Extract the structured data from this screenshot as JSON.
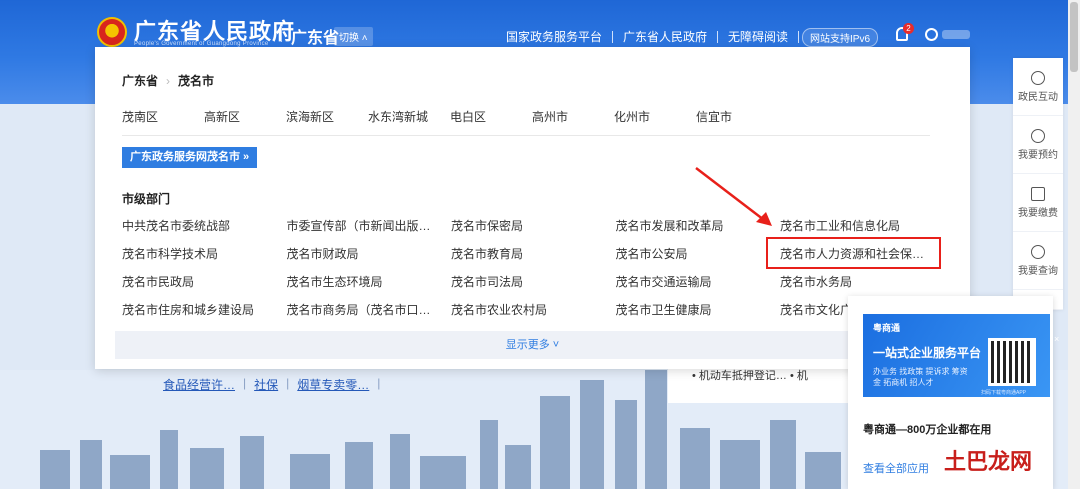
{
  "header": {
    "site_title": "广东省人民政府",
    "site_subtitle": "People's Government of Guangdong Province",
    "region": "广东省",
    "switch_label": "切换",
    "links": [
      "国家政务服务平台",
      "广东省人民政府",
      "无障碍阅读"
    ],
    "ipv6_label": "网站支持IPv6",
    "notification_count": "2"
  },
  "panel": {
    "breadcrumb": [
      "广东省",
      "茂名市"
    ],
    "districts": [
      "茂南区",
      "高新区",
      "滨海新区",
      "水东湾新城",
      "电白区",
      "高州市",
      "化州市",
      "信宜市"
    ],
    "portal_button": "广东政务服务网茂名市 »",
    "section_title": "市级部门",
    "departments": [
      "中共茂名市委统战部",
      "市委宣传部（市新闻出版…",
      "茂名市保密局",
      "茂名市发展和改革局",
      "茂名市工业和信息化局",
      "茂名市科学技术局",
      "茂名市财政局",
      "茂名市教育局",
      "茂名市公安局",
      "茂名市人力资源和社会保…",
      "茂名市民政局",
      "茂名市生态环境局",
      "茂名市司法局",
      "茂名市交通运输局",
      "茂名市水务局",
      "茂名市住房和城乡建设局",
      "茂名市商务局（茂名市口…",
      "茂名市农业农村局",
      "茂名市卫生健康局",
      "茂名市文化广"
    ],
    "show_more": "显示更多"
  },
  "under_links": [
    "食品经营许…",
    "社保",
    "烟草专卖零…"
  ],
  "under_list_item": "• 机动车抵押登记… •  机",
  "right_sidebar": [
    "政民互动",
    "我要预约",
    "我要缴费",
    "我要查询"
  ],
  "ad": {
    "logo": "粤商通",
    "headline": "一站式企业服务平台",
    "tags": "办业务  找政策  提诉求  筹资金  拓商机  招人才",
    "qr_caption": "扫码下载粤商通APP",
    "close": "×",
    "text": "粤商通—800万企业都在用",
    "link": "查看全部应用"
  },
  "watermark": "土巴龙网",
  "colors": {
    "header_blue": "#2f79e3",
    "accent": "#2f7de1",
    "annotation_red": "#e8201a"
  }
}
